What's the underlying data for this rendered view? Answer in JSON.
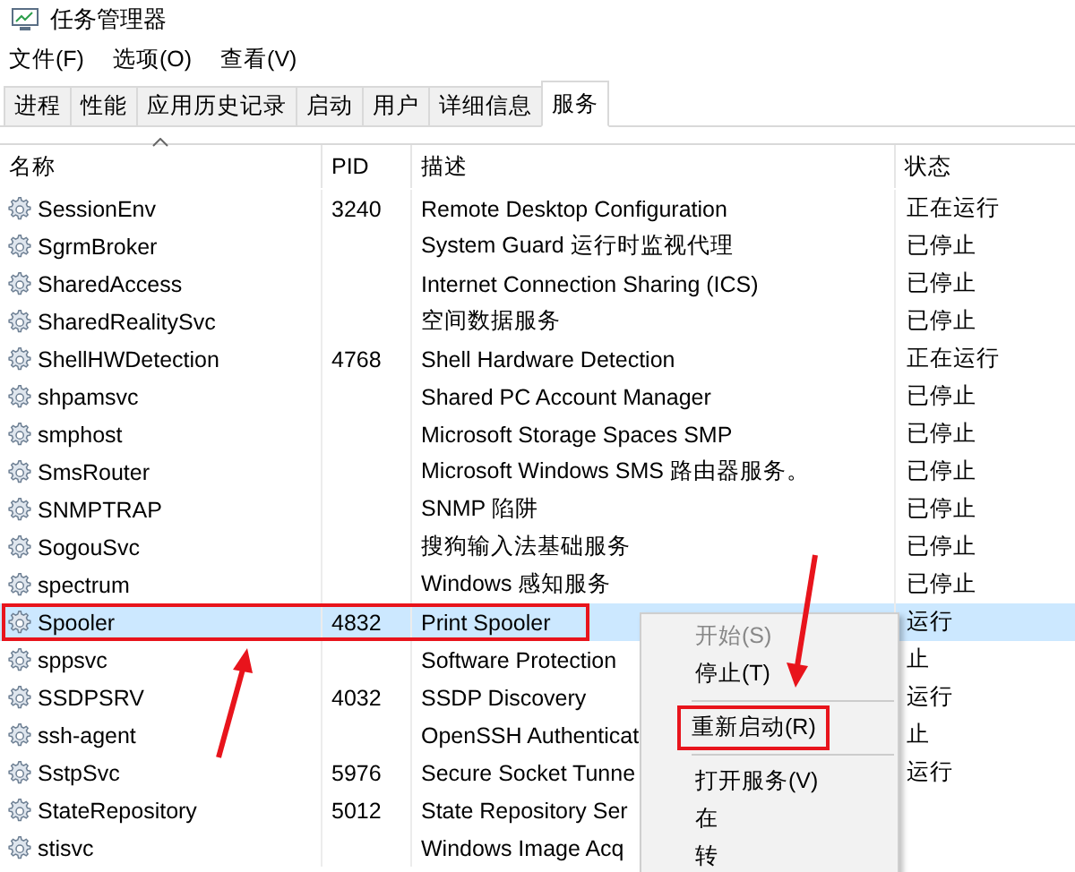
{
  "window": {
    "title": "任务管理器"
  },
  "menu_bar": [
    "文件(F)",
    "选项(O)",
    "查看(V)"
  ],
  "tabs": [
    {
      "label": "进程",
      "selected": false
    },
    {
      "label": "性能",
      "selected": false
    },
    {
      "label": "应用历史记录",
      "selected": false
    },
    {
      "label": "启动",
      "selected": false
    },
    {
      "label": "用户",
      "selected": false
    },
    {
      "label": "详细信息",
      "selected": false
    },
    {
      "label": "服务",
      "selected": true
    }
  ],
  "table": {
    "columns": [
      "名称",
      "PID",
      "描述",
      "状态"
    ],
    "rows": [
      {
        "name": "SessionEnv",
        "pid": "3240",
        "description": "Remote Desktop Configuration",
        "status": "正在运行",
        "selected": false
      },
      {
        "name": "SgrmBroker",
        "description": "System Guard 运行时监视代理",
        "status": "已停止",
        "selected": false
      },
      {
        "name": "SharedAccess",
        "description": "Internet Connection Sharing (ICS)",
        "status": "已停止",
        "selected": false
      },
      {
        "name": "SharedRealitySvc",
        "description": "空间数据服务",
        "status": "已停止",
        "selected": false
      },
      {
        "name": "ShellHWDetection",
        "pid": "4768",
        "description": "Shell Hardware Detection",
        "status": "正在运行",
        "selected": false
      },
      {
        "name": "shpamsvc",
        "description": "Shared PC Account Manager",
        "status": "已停止",
        "selected": false
      },
      {
        "name": "smphost",
        "description": "Microsoft Storage Spaces SMP",
        "status": "已停止",
        "selected": false
      },
      {
        "name": "SmsRouter",
        "description": "Microsoft Windows SMS 路由器服务。",
        "status": "已停止",
        "selected": false
      },
      {
        "name": "SNMPTRAP",
        "description": "SNMP 陷阱",
        "status": "已停止",
        "selected": false
      },
      {
        "name": "SogouSvc",
        "description": "搜狗输入法基础服务",
        "status": "已停止",
        "selected": false
      },
      {
        "name": "spectrum",
        "description": "Windows 感知服务",
        "status": "已停止",
        "selected": false
      },
      {
        "name": "Spooler",
        "pid": "4832",
        "description": "Print Spooler",
        "status": "运行",
        "selected": true
      },
      {
        "name": "sppsvc",
        "description": "Software Protection",
        "status": "止",
        "selected": false
      },
      {
        "name": "SSDPSRV",
        "pid": "4032",
        "description": "SSDP Discovery",
        "status": "运行",
        "selected": false
      },
      {
        "name": "ssh-agent",
        "description": "OpenSSH Authenticat",
        "status": "止",
        "selected": false
      },
      {
        "name": "SstpSvc",
        "pid": "5976",
        "description": "Secure Socket Tunne",
        "status": "运行",
        "selected": false
      },
      {
        "name": "StateRepository",
        "pid": "5012",
        "description": "State Repository Ser",
        "selected": false
      },
      {
        "name": "stisvc",
        "description": "Windows Image Acq",
        "selected": false
      }
    ]
  },
  "context_menu": {
    "items": [
      {
        "kind": "item",
        "label": "开始(S)",
        "disabled": true,
        "highlighted": false
      },
      {
        "kind": "item",
        "label": "停止(T)",
        "disabled": false,
        "highlighted": false
      },
      {
        "kind": "separator"
      },
      {
        "kind": "item",
        "label": "重新启动(R)",
        "disabled": false,
        "highlighted": true
      },
      {
        "kind": "separator"
      },
      {
        "kind": "item",
        "label": "打开服务(V)",
        "disabled": false,
        "highlighted": false
      },
      {
        "kind": "item",
        "label": "在",
        "disabled": false,
        "highlighted": false
      },
      {
        "kind": "item",
        "label": "转",
        "disabled": false,
        "highlighted": false
      }
    ]
  }
}
